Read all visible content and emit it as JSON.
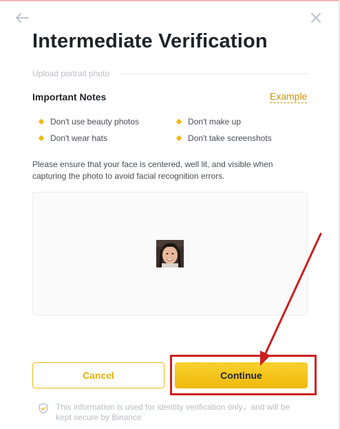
{
  "header": {
    "title": "Intermediate Verification",
    "back_icon": "arrow-left-icon",
    "close_icon": "close-icon"
  },
  "step": {
    "label": "Upload portrait photo"
  },
  "notes": {
    "heading": "Important Notes",
    "example_link": "Example",
    "tips": [
      "Don't use beauty photos",
      "Don't make up",
      "Don't wear hats",
      "Don't take screenshots"
    ]
  },
  "instructions": "Please ensure that your face is centered, well lit, and visible when capturing the photo to avoid facial recognition errors.",
  "actions": {
    "cancel_label": "Cancel",
    "continue_label": "Continue"
  },
  "security": {
    "text": "This information is used for identity verification only，and will be kept secure by Binance",
    "icon": "shield-check-icon"
  },
  "colors": {
    "brand_yellow": "#F0B90B",
    "link_gold": "#C99400",
    "annotation_red": "#CC1F1F"
  }
}
